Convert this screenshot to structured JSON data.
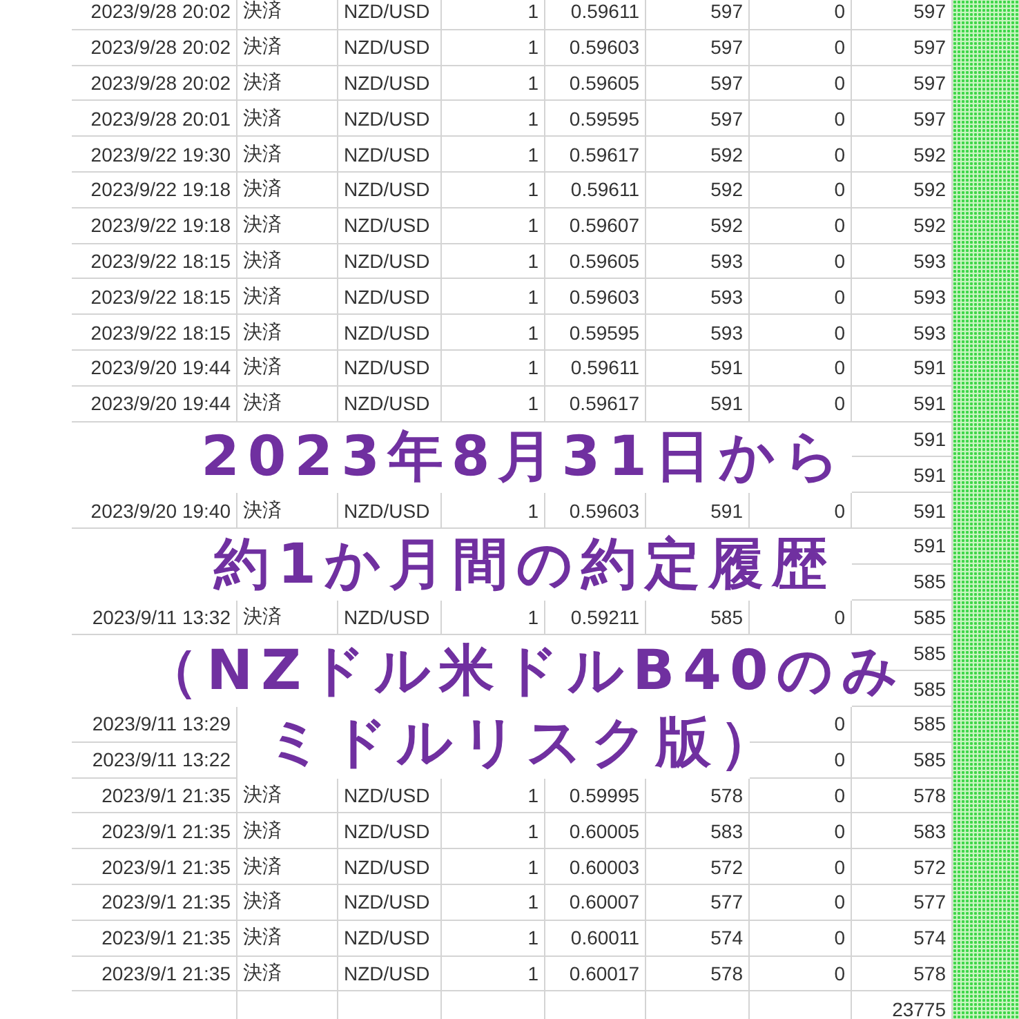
{
  "sheet": {
    "rows": [
      {
        "datetime": "2023/9/28 20:02",
        "type": "決済",
        "pair": "NZD/USD",
        "lots": "1",
        "price": "0.59611",
        "col_6": "597",
        "col_7": "0",
        "col_8": "597"
      },
      {
        "datetime": "2023/9/28 20:02",
        "type": "決済",
        "pair": "NZD/USD",
        "lots": "1",
        "price": "0.59603",
        "col_6": "597",
        "col_7": "0",
        "col_8": "597"
      },
      {
        "datetime": "2023/9/28 20:02",
        "type": "決済",
        "pair": "NZD/USD",
        "lots": "1",
        "price": "0.59605",
        "col_6": "597",
        "col_7": "0",
        "col_8": "597"
      },
      {
        "datetime": "2023/9/28 20:01",
        "type": "決済",
        "pair": "NZD/USD",
        "lots": "1",
        "price": "0.59595",
        "col_6": "597",
        "col_7": "0",
        "col_8": "597"
      },
      {
        "datetime": "2023/9/22 19:30",
        "type": "決済",
        "pair": "NZD/USD",
        "lots": "1",
        "price": "0.59617",
        "col_6": "592",
        "col_7": "0",
        "col_8": "592"
      },
      {
        "datetime": "2023/9/22 19:18",
        "type": "決済",
        "pair": "NZD/USD",
        "lots": "1",
        "price": "0.59611",
        "col_6": "592",
        "col_7": "0",
        "col_8": "592"
      },
      {
        "datetime": "2023/9/22 19:18",
        "type": "決済",
        "pair": "NZD/USD",
        "lots": "1",
        "price": "0.59607",
        "col_6": "592",
        "col_7": "0",
        "col_8": "592"
      },
      {
        "datetime": "2023/9/22 18:15",
        "type": "決済",
        "pair": "NZD/USD",
        "lots": "1",
        "price": "0.59605",
        "col_6": "593",
        "col_7": "0",
        "col_8": "593"
      },
      {
        "datetime": "2023/9/22 18:15",
        "type": "決済",
        "pair": "NZD/USD",
        "lots": "1",
        "price": "0.59603",
        "col_6": "593",
        "col_7": "0",
        "col_8": "593"
      },
      {
        "datetime": "2023/9/22 18:15",
        "type": "決済",
        "pair": "NZD/USD",
        "lots": "1",
        "price": "0.59595",
        "col_6": "593",
        "col_7": "0",
        "col_8": "593"
      },
      {
        "datetime": "2023/9/20 19:44",
        "type": "決済",
        "pair": "NZD/USD",
        "lots": "1",
        "price": "0.59611",
        "col_6": "591",
        "col_7": "0",
        "col_8": "591"
      },
      {
        "datetime": "2023/9/20 19:44",
        "type": "決済",
        "pair": "NZD/USD",
        "lots": "1",
        "price": "0.59617",
        "col_6": "591",
        "col_7": "0",
        "col_8": "591"
      },
      {
        "col_8": "591"
      },
      {
        "col_8": "591"
      },
      {
        "datetime": "2023/9/20 19:40",
        "type": "決済",
        "pair": "NZD/USD",
        "lots": "1",
        "price": "0.59603",
        "col_6": "591",
        "col_7": "0",
        "col_8": "591"
      },
      {
        "col_8": "591"
      },
      {
        "col_8": "585"
      },
      {
        "datetime": "2023/9/11 13:32",
        "type": "決済",
        "pair": "NZD/USD",
        "lots": "1",
        "price": "0.59211",
        "col_6": "585",
        "col_7": "0",
        "col_8": "585"
      },
      {
        "col_8": "585"
      },
      {
        "col_8": "585"
      },
      {
        "datetime": "2023/9/11 13:29",
        "col_7": "0",
        "col_8": "585"
      },
      {
        "datetime": "2023/9/11 13:22",
        "col_7": "0",
        "col_8": "585"
      },
      {
        "datetime": "2023/9/1 21:35",
        "type": "決済",
        "pair": "NZD/USD",
        "lots": "1",
        "price": "0.59995",
        "col_6": "578",
        "col_7": "0",
        "col_8": "578"
      },
      {
        "datetime": "2023/9/1 21:35",
        "type": "決済",
        "pair": "NZD/USD",
        "lots": "1",
        "price": "0.60005",
        "col_6": "583",
        "col_7": "0",
        "col_8": "583"
      },
      {
        "datetime": "2023/9/1 21:35",
        "type": "決済",
        "pair": "NZD/USD",
        "lots": "1",
        "price": "0.60003",
        "col_6": "572",
        "col_7": "0",
        "col_8": "572"
      },
      {
        "datetime": "2023/9/1 21:35",
        "type": "決済",
        "pair": "NZD/USD",
        "lots": "1",
        "price": "0.60007",
        "col_6": "577",
        "col_7": "0",
        "col_8": "577"
      },
      {
        "datetime": "2023/9/1 21:35",
        "type": "決済",
        "pair": "NZD/USD",
        "lots": "1",
        "price": "0.60011",
        "col_6": "574",
        "col_7": "0",
        "col_8": "574"
      },
      {
        "datetime": "2023/9/1 21:35",
        "type": "決済",
        "pair": "NZD/USD",
        "lots": "1",
        "price": "0.60017",
        "col_6": "578",
        "col_7": "0",
        "col_8": "578"
      }
    ],
    "total": "23775"
  },
  "caption": {
    "lines": [
      "2023年8月31日から",
      "約1か月間の約定履歴",
      "（NZドル米ドルB40のみ",
      "ミドルリスク版）"
    ]
  }
}
